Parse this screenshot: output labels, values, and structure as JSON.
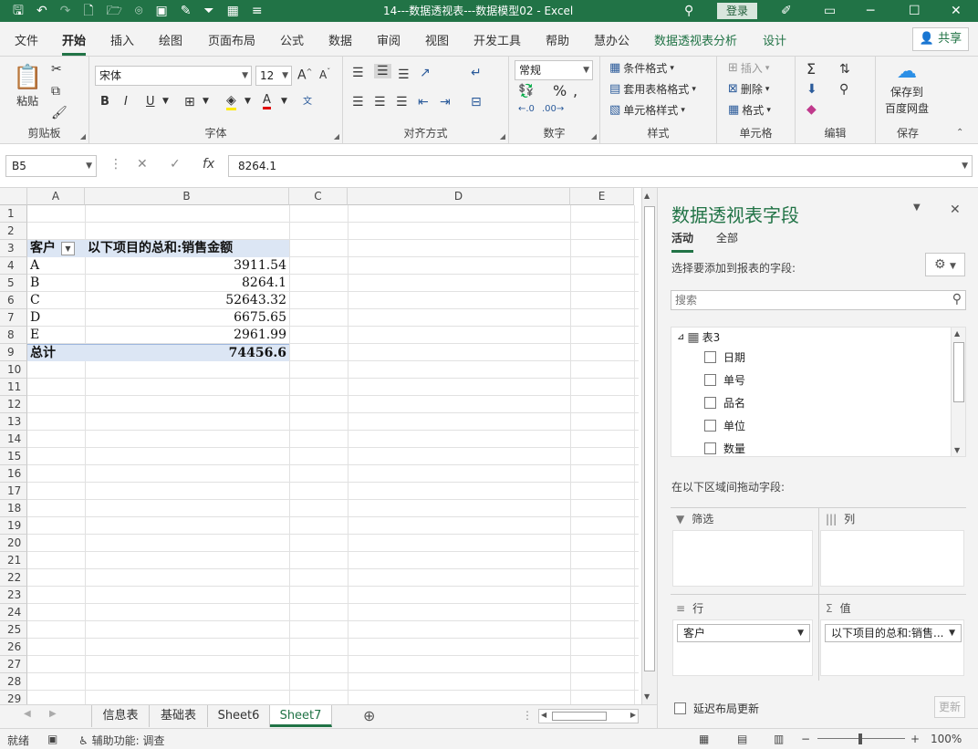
{
  "window": {
    "title": "14---数据透视表---数据模型02  -  Excel",
    "login_label": "登录"
  },
  "tabs": [
    "文件",
    "开始",
    "插入",
    "绘图",
    "页面布局",
    "公式",
    "数据",
    "审阅",
    "视图",
    "开发工具",
    "帮助",
    "慧办公",
    "数据透视表分析",
    "设计"
  ],
  "share_label": "共享",
  "ribbon": {
    "clipboard": {
      "paste": "粘贴",
      "label": "剪贴板"
    },
    "font": {
      "name": "宋体",
      "size": "12",
      "label": "字体",
      "bold": "B",
      "italic": "I",
      "underline": "U"
    },
    "alignment": {
      "label": "对齐方式"
    },
    "number": {
      "format": "常规",
      "label": "数字"
    },
    "styles": {
      "conditional": "条件格式",
      "table": "套用表格格式",
      "cell": "单元格样式",
      "label": "样式"
    },
    "cells": {
      "insert": "插入",
      "delete": "删除",
      "format": "格式",
      "label": "单元格"
    },
    "editing": {
      "label": "编辑"
    },
    "save": {
      "line1": "保存到",
      "line2": "百度网盘",
      "label": "保存"
    }
  },
  "formula_bar": {
    "name_box": "B5",
    "value": "8264.1"
  },
  "columns": [
    "A",
    "B",
    "C",
    "D",
    "E"
  ],
  "rows": [
    "1",
    "2",
    "3",
    "4",
    "5",
    "6",
    "7",
    "8",
    "9",
    "10",
    "11",
    "12",
    "13",
    "14",
    "15",
    "16",
    "17",
    "18",
    "19",
    "20",
    "21",
    "22",
    "23",
    "24",
    "25",
    "26",
    "27",
    "28",
    "29"
  ],
  "pivot": {
    "row_header": "客户",
    "value_header": "以下项目的总和:销售金额",
    "rows": [
      {
        "label": "A",
        "value": "3911.54"
      },
      {
        "label": "B",
        "value": "8264.1"
      },
      {
        "label": "C",
        "value": "52643.32"
      },
      {
        "label": "D",
        "value": "6675.65"
      },
      {
        "label": "E",
        "value": "2961.99"
      }
    ],
    "total_label": "总计",
    "total_value": "74456.6"
  },
  "sheets": [
    "信息表",
    "基础表",
    "Sheet6",
    "Sheet7"
  ],
  "active_sheet": "Sheet7",
  "status": {
    "ready": "就绪",
    "accessibility": "辅助功能: 调查",
    "zoom": "100%"
  },
  "pane": {
    "title": "数据透视表字段",
    "tab_active": "活动",
    "tab_all": "全部",
    "choose_label": "选择要添加到报表的字段:",
    "search_placeholder": "搜索",
    "table_name": "表3",
    "fields": [
      "日期",
      "单号",
      "品名",
      "单位",
      "数量"
    ],
    "drag_label": "在以下区域间拖动字段:",
    "filter_label": "筛选",
    "columns_label": "列",
    "rows_label": "行",
    "values_label": "值",
    "rows_item": "客户",
    "values_item": "以下项目的总和:销售...",
    "defer_label": "延迟布局更新",
    "update_label": "更新"
  }
}
